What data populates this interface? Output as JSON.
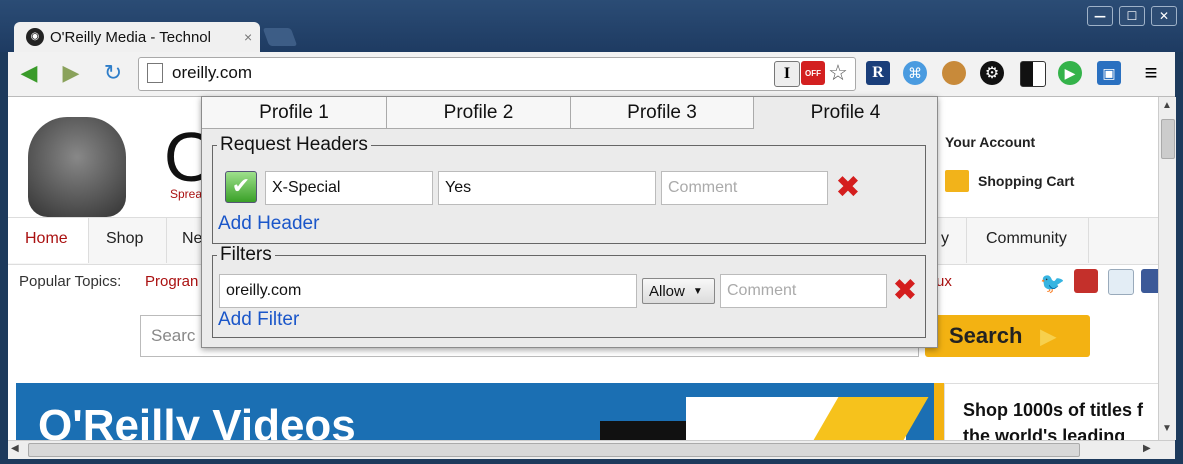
{
  "browser": {
    "tab_title": "O'Reilly Media - Technol",
    "tab_close": "×",
    "url": "oreilly.com",
    "window_min": "—",
    "window_max": "☐",
    "window_close": "✕",
    "menu_icon": "≡"
  },
  "page": {
    "account_link": "Your Account",
    "cart_link": "Shopping Cart",
    "tagline_partial": "Sprea",
    "nav_items": [
      {
        "label": "Home"
      },
      {
        "label": "Shop"
      },
      {
        "label": "Ne"
      },
      {
        "label": "y"
      },
      {
        "label": "Community"
      }
    ],
    "popular_label": "Popular Topics:",
    "popular_partial_left": "Progran",
    "popular_partial_right": "ux",
    "search_placeholder": "Searc",
    "search_button": "Search",
    "banner_text": "O'Reilly Videos",
    "promo_line1": "Shop 1000s of titles f",
    "promo_line2": "the world's leading"
  },
  "popup": {
    "profiles": [
      {
        "label": "Profile 1",
        "active": false
      },
      {
        "label": "Profile 2",
        "active": false
      },
      {
        "label": "Profile 3",
        "active": false
      },
      {
        "label": "Profile 4",
        "active": true
      }
    ],
    "headers_title": "Request Headers",
    "header_row": {
      "name": "X-Special",
      "value": "Yes",
      "comment_placeholder": "Comment"
    },
    "add_header": "Add Header",
    "filters_title": "Filters",
    "filter_row": {
      "value": "oreilly.com",
      "action": "Allow",
      "comment_placeholder": "Comment"
    },
    "add_filter": "Add Filter"
  }
}
